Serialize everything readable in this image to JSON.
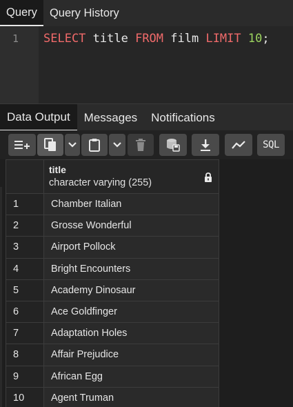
{
  "query_tabs": [
    {
      "label": "Query",
      "active": true
    },
    {
      "label": "Query History",
      "active": false
    }
  ],
  "editor": {
    "line_number": "1",
    "tokens": {
      "select": "SELECT",
      "column": " title ",
      "from": "FROM",
      "table": " film ",
      "limit": "LIMIT",
      "space": " ",
      "count": "10",
      "end": ";"
    }
  },
  "output_tabs": [
    {
      "label": "Data Output",
      "active": true
    },
    {
      "label": "Messages",
      "active": false
    },
    {
      "label": "Notifications",
      "active": false
    }
  ],
  "toolbar": {
    "sql_label": "SQL"
  },
  "grid": {
    "column": {
      "name": "title",
      "type": "character varying (255)"
    },
    "rows": [
      {
        "num": "1",
        "title": "Chamber Italian"
      },
      {
        "num": "2",
        "title": "Grosse Wonderful"
      },
      {
        "num": "3",
        "title": "Airport Pollock"
      },
      {
        "num": "4",
        "title": "Bright Encounters"
      },
      {
        "num": "5",
        "title": "Academy Dinosaur"
      },
      {
        "num": "6",
        "title": "Ace Goldfinger"
      },
      {
        "num": "7",
        "title": "Adaptation Holes"
      },
      {
        "num": "8",
        "title": "Affair Prejudice"
      },
      {
        "num": "9",
        "title": "African Egg"
      },
      {
        "num": "10",
        "title": "Agent Truman"
      }
    ]
  },
  "colors": {
    "keyword": "#f06a6a",
    "number": "#9bd35e",
    "background": "#1e1e1e"
  }
}
